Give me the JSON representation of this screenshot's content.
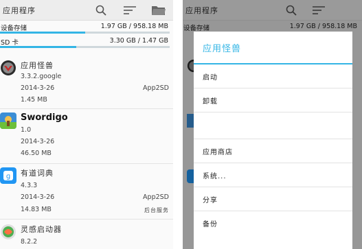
{
  "left": {
    "title": "应用程序",
    "storage": [
      {
        "label": "设备存储",
        "value": "1.97 GB / 958.18 MB",
        "fill": 0.5
      },
      {
        "label": "SD 卡",
        "value": "3.30 GB / 1.47 GB",
        "fill": 0.45
      }
    ],
    "apps": [
      {
        "name": "应用怪兽",
        "version": "3.3.2.google",
        "date": "2014-3-26",
        "size": "1.45 MB",
        "tag": "App2SD",
        "note": ""
      },
      {
        "name": "Swordigo",
        "version": "1.0",
        "date": "2014-3-26",
        "size": "46.50 MB",
        "tag": "",
        "note": ""
      },
      {
        "name": "有道词典",
        "version": "4.3.3",
        "date": "2014-3-26",
        "size": "14.83 MB",
        "tag": "App2SD",
        "note": "后台服务"
      },
      {
        "name": "灵感启动器",
        "version": "8.2.2",
        "date": "",
        "size": "",
        "tag": "",
        "note": ""
      }
    ]
  },
  "right": {
    "title": "应用程序",
    "storage_value": "1.97 GB / 958.18 MB",
    "dialog": {
      "title": "应用怪兽",
      "items": [
        "启动",
        "卸载",
        "",
        "应用商店",
        "系统...",
        "分享",
        "备份"
      ]
    }
  },
  "colors": {
    "accent": "#33b5e5",
    "appbar": "#ededed"
  },
  "icons": [
    "search-icon",
    "sort-icon",
    "folder-icon",
    "monster-app-icon",
    "swordigo-app-icon",
    "youdao-app-icon",
    "launcher-app-icon"
  ]
}
